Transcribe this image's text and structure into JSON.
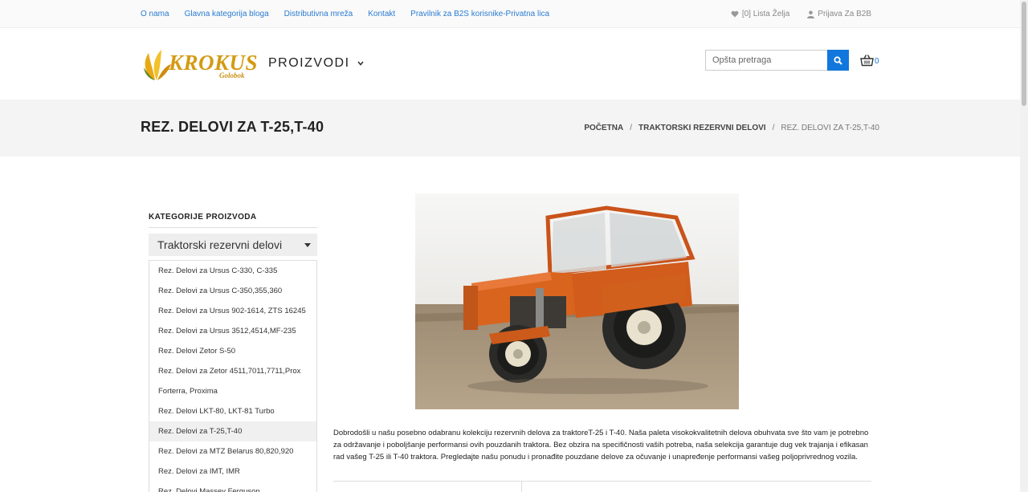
{
  "topnav": {
    "links": [
      "O nama",
      "Glavna kategorija bloga",
      "Distributivna mreža",
      "Kontakt",
      "Pravilnik za B2S korisnike-Privatna lica"
    ],
    "wishlist": "[0] Lista Želja",
    "login": "Prijava Za B2B"
  },
  "header": {
    "logo_text": "KROKUS",
    "logo_sub": "Golobok",
    "products_label": "PROIZVODI",
    "search_placeholder": "Opšta pretraga",
    "cart_count": "0"
  },
  "page": {
    "title": "REZ. DELOVI ZA T-25,T-40",
    "breadcrumb": [
      "POČETNA",
      "TRAKTORSKI REZERVNI DELOVI",
      "REZ. DELOVI ZA T-25,T-40"
    ]
  },
  "sidebar": {
    "title": "KATEGORIJE PROIZVODA",
    "selected": "Traktorski rezervni delovi",
    "items": [
      "Rez. Delovi za Ursus C-330, C-335",
      "Rez. Delovi za Ursus C-350,355,360",
      "Rez. Delovi za Ursus 902-1614, ZTS 16245",
      "Rez. Delovi za Ursus 3512,4514,MF-235",
      "Rez. Delovi Zetor S-50",
      "Rez. Delovi za Zetor 4511,7011,7711,Prox",
      "Forterra, Proxima",
      "Rez. Delovi LKT-80, LKT-81 Turbo",
      "Rez. Delovi za T-25,T-40",
      "Rez. Delovi za MTZ Belarus 80,820,920",
      "Rez. Delovi za IMT, IMR",
      "Rez. Delovi Massey Ferguson"
    ],
    "active_index": 8
  },
  "main": {
    "description": "Dobrodošli u našu posebno odabranu kolekciju rezervnih delova za traktoreT-25 i T-40. Naša paleta visokokvalitetnih delova obuhvata sve što vam je potrebno za održavanje i poboljšanje performansi ovih pouzdanih traktora. Bez obzira na specifičnosti vaših potreba, naša selekcija garantuje dug vek trajanja i efikasan rad vašeg T-25 ili T-40 traktora. Pregledajte našu ponudu i pronađite pouzdane delove za očuvanje i unapređenje performansi vašeg poljoprivrednog vozila."
  },
  "colors": {
    "link": "#2a7bd1",
    "accent": "#1177dd",
    "logo": "#d49a12",
    "tractor": "#d9641e"
  }
}
